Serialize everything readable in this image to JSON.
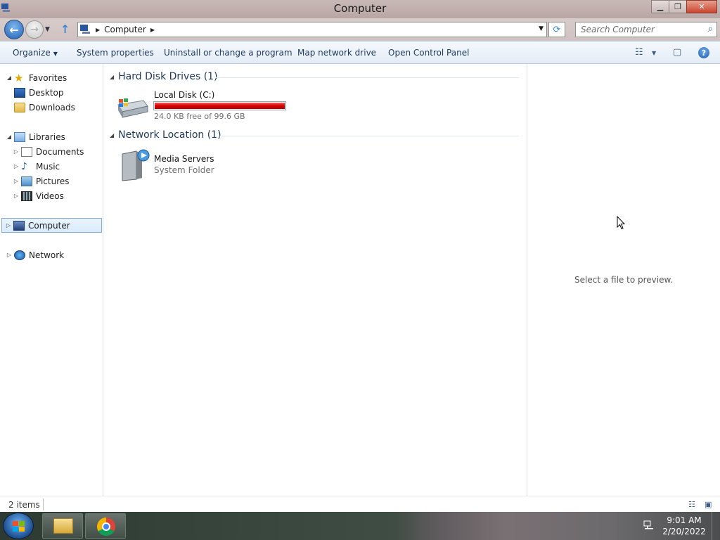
{
  "window": {
    "title": "Computer"
  },
  "address": {
    "crumbs": [
      "Computer"
    ]
  },
  "search": {
    "placeholder": "Search Computer"
  },
  "commandbar": {
    "organize": "Organize",
    "system_properties": "System properties",
    "uninstall": "Uninstall or change a program",
    "map_drive": "Map network drive",
    "control_panel": "Open Control Panel"
  },
  "navpane": {
    "favorites": "Favorites",
    "desktop": "Desktop",
    "downloads": "Downloads",
    "libraries": "Libraries",
    "documents": "Documents",
    "music": "Music",
    "pictures": "Pictures",
    "videos": "Videos",
    "computer": "Computer",
    "network": "Network"
  },
  "content": {
    "hdd_group": "Hard Disk Drives (1)",
    "drive_name": "Local Disk (C:)",
    "drive_free": "24.0 KB free of 99.6 GB",
    "drive_used_fraction": 0.9999,
    "net_group": "Network Location (1)",
    "media_name": "Media Servers",
    "media_sub": "System Folder"
  },
  "preview": {
    "message": "Select a file to preview."
  },
  "status": {
    "count": "2 items"
  },
  "taskbar": {
    "time": "9:01 AM",
    "date": "2/20/2022"
  },
  "colors": {
    "drive_bar": "#d40000",
    "accent": "#1e395b"
  }
}
